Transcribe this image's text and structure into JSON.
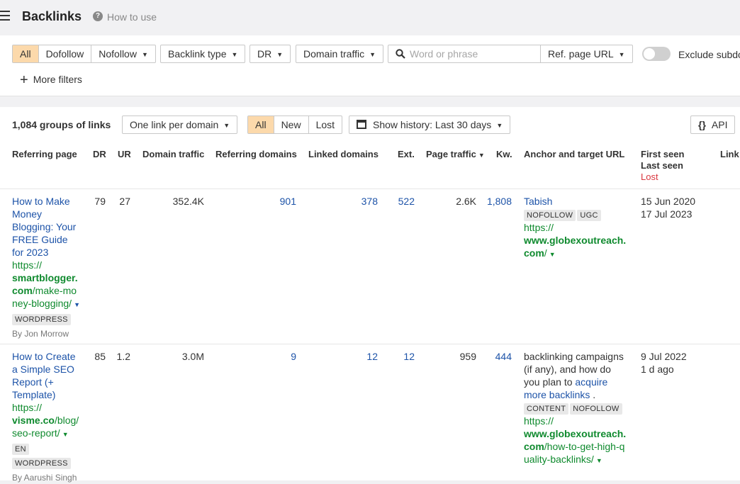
{
  "header": {
    "title": "Backlinks",
    "help_label": "How to use"
  },
  "filters": {
    "link_type_segments": [
      "All",
      "Dofollow",
      "Nofollow"
    ],
    "backlink_type": "Backlink type",
    "dr": "DR",
    "domain_traffic": "Domain traffic",
    "search_placeholder": "Word or phrase",
    "search_value": "",
    "search_scope": "Ref. page URL",
    "exclude_label": "Exclude subdo",
    "exclude_enabled": false,
    "more_filters": "More filters"
  },
  "results_bar": {
    "groups_count": "1,084 groups of links",
    "grouping": "One link per domain",
    "status_segments": [
      "All",
      "New",
      "Lost"
    ],
    "history": "Show history: Last 30 days",
    "api_label": "API"
  },
  "table": {
    "columns": {
      "referring_page": "Referring page",
      "dr": "DR",
      "ur": "UR",
      "domain_traffic": "Domain traffic",
      "referring_domains": "Referring domains",
      "linked_domains": "Linked domains",
      "ext": "Ext.",
      "page_traffic": "Page traffic",
      "kw": "Kw.",
      "anchor": "Anchor and target URL",
      "first_seen": "First seen",
      "last_seen": "Last seen",
      "lost": "Lost",
      "links": "Link"
    },
    "rows": [
      {
        "title_lines": [
          "How to Make",
          "Money",
          "Blogging: Your",
          "FREE Guide",
          "for 2023"
        ],
        "url_prefix": "https://",
        "url_domain_lines": [
          "smartblogger.",
          "com"
        ],
        "url_path_lines": [
          "/make-mo",
          "ney-blogging/"
        ],
        "badges": [
          "WORDPRESS"
        ],
        "author": "By Jon Morrow",
        "dr": "79",
        "ur": "27",
        "domain_traffic": "352.4K",
        "referring_domains": "901",
        "linked_domains": "378",
        "ext": "522",
        "page_traffic": "2.6K",
        "kw": "1,808",
        "anchor_text": "Tabish",
        "anchor_badges": [
          "NOFOLLOW",
          "UGC"
        ],
        "target_prefix": "https://",
        "target_domain": "www.globexoutreach.",
        "target_com": "com",
        "target_path": "/",
        "first_seen": "15 Jun 2020",
        "last_seen": "17 Jul 2023"
      },
      {
        "title_lines": [
          "How to Create",
          "a Simple SEO",
          "Report (+",
          "Template)"
        ],
        "url_prefix": "https://",
        "url_domain": "visme.co",
        "url_path_lines": [
          "/blog/",
          "seo-report/"
        ],
        "badges": [
          "EN",
          "WORDPRESS"
        ],
        "author": "By Aarushi Singh",
        "dr": "85",
        "ur": "1.2",
        "domain_traffic": "3.0M",
        "referring_domains": "9",
        "linked_domains": "12",
        "ext": "12",
        "page_traffic": "959",
        "kw": "444",
        "anchor_lines": [
          "backlinking campaigns",
          "(if any), and how do",
          "you plan to "
        ],
        "anchor_link_lines": [
          "acquire",
          "more backlinks"
        ],
        "anchor_suffix": " .",
        "anchor_badges": [
          "CONTENT",
          "NOFOLLOW"
        ],
        "target_prefix": "https://",
        "target_domain": "www.globexoutreach.",
        "target_com": "com",
        "target_path_lines": [
          "/how-to-get-high-q",
          "uality-backlinks/"
        ],
        "first_seen": "9 Jul 2022",
        "last_seen": "1 d ago"
      }
    ]
  },
  "icons": {
    "menu": "menu-icon",
    "help": "question-circle-icon",
    "search": "search-icon",
    "calendar": "calendar-icon",
    "api": "braces-icon",
    "plus": "plus-icon"
  },
  "colors": {
    "active_segment": "#fcd9ab",
    "link_blue": "#1d53a8",
    "url_green": "#0f8a2e",
    "lost_red": "#d9363e"
  }
}
